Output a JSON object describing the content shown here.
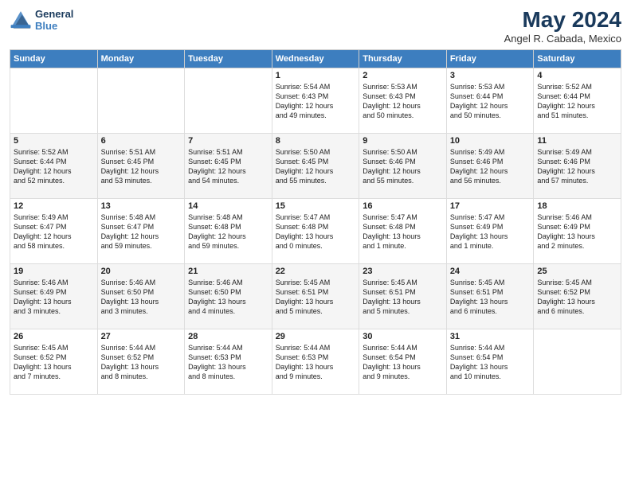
{
  "logo": {
    "line1": "General",
    "line2": "Blue"
  },
  "title": "May 2024",
  "subtitle": "Angel R. Cabada, Mexico",
  "days_of_week": [
    "Sunday",
    "Monday",
    "Tuesday",
    "Wednesday",
    "Thursday",
    "Friday",
    "Saturday"
  ],
  "weeks": [
    [
      {
        "day": "",
        "info": ""
      },
      {
        "day": "",
        "info": ""
      },
      {
        "day": "",
        "info": ""
      },
      {
        "day": "1",
        "info": "Sunrise: 5:54 AM\nSunset: 6:43 PM\nDaylight: 12 hours\nand 49 minutes."
      },
      {
        "day": "2",
        "info": "Sunrise: 5:53 AM\nSunset: 6:43 PM\nDaylight: 12 hours\nand 50 minutes."
      },
      {
        "day": "3",
        "info": "Sunrise: 5:53 AM\nSunset: 6:44 PM\nDaylight: 12 hours\nand 50 minutes."
      },
      {
        "day": "4",
        "info": "Sunrise: 5:52 AM\nSunset: 6:44 PM\nDaylight: 12 hours\nand 51 minutes."
      }
    ],
    [
      {
        "day": "5",
        "info": "Sunrise: 5:52 AM\nSunset: 6:44 PM\nDaylight: 12 hours\nand 52 minutes."
      },
      {
        "day": "6",
        "info": "Sunrise: 5:51 AM\nSunset: 6:45 PM\nDaylight: 12 hours\nand 53 minutes."
      },
      {
        "day": "7",
        "info": "Sunrise: 5:51 AM\nSunset: 6:45 PM\nDaylight: 12 hours\nand 54 minutes."
      },
      {
        "day": "8",
        "info": "Sunrise: 5:50 AM\nSunset: 6:45 PM\nDaylight: 12 hours\nand 55 minutes."
      },
      {
        "day": "9",
        "info": "Sunrise: 5:50 AM\nSunset: 6:46 PM\nDaylight: 12 hours\nand 55 minutes."
      },
      {
        "day": "10",
        "info": "Sunrise: 5:49 AM\nSunset: 6:46 PM\nDaylight: 12 hours\nand 56 minutes."
      },
      {
        "day": "11",
        "info": "Sunrise: 5:49 AM\nSunset: 6:46 PM\nDaylight: 12 hours\nand 57 minutes."
      }
    ],
    [
      {
        "day": "12",
        "info": "Sunrise: 5:49 AM\nSunset: 6:47 PM\nDaylight: 12 hours\nand 58 minutes."
      },
      {
        "day": "13",
        "info": "Sunrise: 5:48 AM\nSunset: 6:47 PM\nDaylight: 12 hours\nand 59 minutes."
      },
      {
        "day": "14",
        "info": "Sunrise: 5:48 AM\nSunset: 6:48 PM\nDaylight: 12 hours\nand 59 minutes."
      },
      {
        "day": "15",
        "info": "Sunrise: 5:47 AM\nSunset: 6:48 PM\nDaylight: 13 hours\nand 0 minutes."
      },
      {
        "day": "16",
        "info": "Sunrise: 5:47 AM\nSunset: 6:48 PM\nDaylight: 13 hours\nand 1 minute."
      },
      {
        "day": "17",
        "info": "Sunrise: 5:47 AM\nSunset: 6:49 PM\nDaylight: 13 hours\nand 1 minute."
      },
      {
        "day": "18",
        "info": "Sunrise: 5:46 AM\nSunset: 6:49 PM\nDaylight: 13 hours\nand 2 minutes."
      }
    ],
    [
      {
        "day": "19",
        "info": "Sunrise: 5:46 AM\nSunset: 6:49 PM\nDaylight: 13 hours\nand 3 minutes."
      },
      {
        "day": "20",
        "info": "Sunrise: 5:46 AM\nSunset: 6:50 PM\nDaylight: 13 hours\nand 3 minutes."
      },
      {
        "day": "21",
        "info": "Sunrise: 5:46 AM\nSunset: 6:50 PM\nDaylight: 13 hours\nand 4 minutes."
      },
      {
        "day": "22",
        "info": "Sunrise: 5:45 AM\nSunset: 6:51 PM\nDaylight: 13 hours\nand 5 minutes."
      },
      {
        "day": "23",
        "info": "Sunrise: 5:45 AM\nSunset: 6:51 PM\nDaylight: 13 hours\nand 5 minutes."
      },
      {
        "day": "24",
        "info": "Sunrise: 5:45 AM\nSunset: 6:51 PM\nDaylight: 13 hours\nand 6 minutes."
      },
      {
        "day": "25",
        "info": "Sunrise: 5:45 AM\nSunset: 6:52 PM\nDaylight: 13 hours\nand 6 minutes."
      }
    ],
    [
      {
        "day": "26",
        "info": "Sunrise: 5:45 AM\nSunset: 6:52 PM\nDaylight: 13 hours\nand 7 minutes."
      },
      {
        "day": "27",
        "info": "Sunrise: 5:44 AM\nSunset: 6:52 PM\nDaylight: 13 hours\nand 8 minutes."
      },
      {
        "day": "28",
        "info": "Sunrise: 5:44 AM\nSunset: 6:53 PM\nDaylight: 13 hours\nand 8 minutes."
      },
      {
        "day": "29",
        "info": "Sunrise: 5:44 AM\nSunset: 6:53 PM\nDaylight: 13 hours\nand 9 minutes."
      },
      {
        "day": "30",
        "info": "Sunrise: 5:44 AM\nSunset: 6:54 PM\nDaylight: 13 hours\nand 9 minutes."
      },
      {
        "day": "31",
        "info": "Sunrise: 5:44 AM\nSunset: 6:54 PM\nDaylight: 13 hours\nand 10 minutes."
      },
      {
        "day": "",
        "info": ""
      }
    ]
  ]
}
